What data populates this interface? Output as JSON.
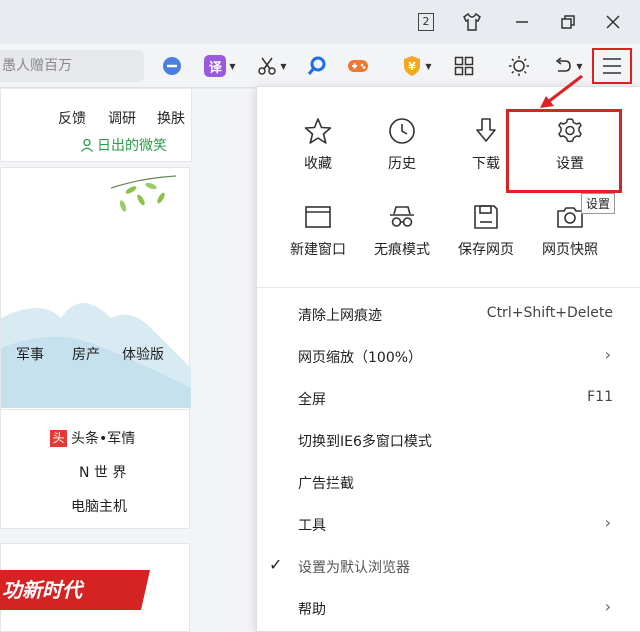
{
  "titlebar": {
    "badge_number": "2"
  },
  "toolbar": {
    "search_text": "愚人赠百万",
    "translate_label": "译"
  },
  "page": {
    "top_links": [
      "反馈",
      "调研",
      "换肤"
    ],
    "user_name": "日出的微笑",
    "nav_links": [
      "军事",
      "房产",
      "体验版"
    ],
    "news_items": [
      "头条•军情",
      "N 世 界",
      "电脑主机"
    ],
    "news_badge": "头",
    "banner_text": "功新时代"
  },
  "menu": {
    "grid": [
      {
        "label": "收藏",
        "icon": "star-icon"
      },
      {
        "label": "历史",
        "icon": "clock-icon"
      },
      {
        "label": "下载",
        "icon": "download-icon"
      },
      {
        "label": "设置",
        "icon": "gear-icon"
      },
      {
        "label": "新建窗口",
        "icon": "window-icon"
      },
      {
        "label": "无痕模式",
        "icon": "incognito-icon"
      },
      {
        "label": "保存网页",
        "icon": "save-icon"
      },
      {
        "label": "网页快照",
        "icon": "camera-icon"
      }
    ],
    "tooltip": "设置",
    "items": [
      {
        "label": "清除上网痕迹",
        "shortcut": "Ctrl+Shift+Delete"
      },
      {
        "label": "网页缩放（100%）",
        "arrow": "›"
      },
      {
        "label": "全屏",
        "shortcut": "F11"
      },
      {
        "label": "切换到IE6多窗口模式"
      },
      {
        "label": "广告拦截"
      },
      {
        "label": "工具",
        "arrow": "›"
      },
      {
        "label": "设置为默认浏览器",
        "check": "✓"
      },
      {
        "label": "帮助",
        "arrow": "›"
      }
    ]
  },
  "colors": {
    "accent_red": "#d22222",
    "user_green": "#2a9d4b"
  }
}
